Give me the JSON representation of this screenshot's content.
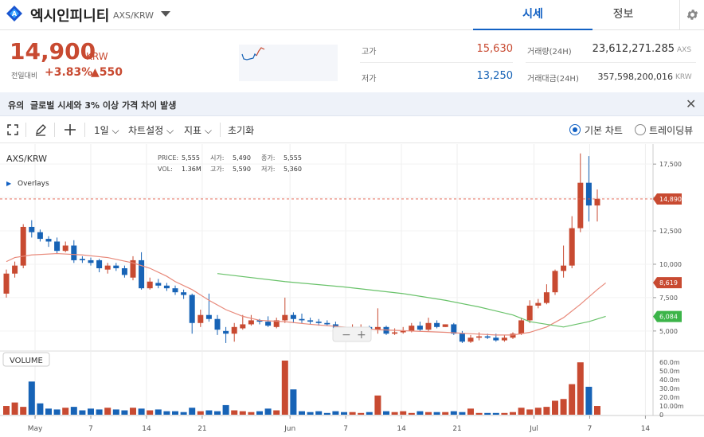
{
  "header": {
    "coin_name": "엑시인피니티",
    "coin_code": "AXS/KRW",
    "tabs": [
      {
        "label": "시세",
        "active": true
      },
      {
        "label": "정보",
        "active": false
      }
    ],
    "settings_icon": "gear-icon"
  },
  "summary": {
    "price": "14,900",
    "unit": "KRW",
    "change_label": "전일대비",
    "change_rate": "+3.83%",
    "change_amount": "▲550",
    "high_label": "고가",
    "high_value": "15,630",
    "low_label": "저가",
    "low_value": "13,250",
    "volume_label": "거래량(24H)",
    "volume_value": "23,612,271.285",
    "volume_unit": "AXS",
    "amount_label": "거래대금(24H)",
    "amount_value": "357,598,200,016",
    "amount_unit": "KRW"
  },
  "notice": {
    "tag": "유의",
    "text": "글로벌 시세와 3% 이상 가격 차이 발생",
    "close_icon": "close-icon"
  },
  "toolbar": {
    "fullscreen_icon": "fullscreen-icon",
    "draw_icon": "pencil-icon",
    "crosshair_icon": "crosshair-icon",
    "interval": "1일",
    "chart_settings": "차트설정",
    "indicators": "지표",
    "reset": "초기화",
    "mode_basic": "기본 차트",
    "mode_tradingview": "트레이딩뷰",
    "selected_mode": "기본 차트"
  },
  "chart_info": {
    "symbol": "AXS/KRW",
    "overlays": "Overlays",
    "price_label": "PRICE:",
    "price_value": "5,555",
    "open_label": "시가:",
    "open_value": "5,490",
    "close_label": "종가:",
    "close_value": "5,555",
    "vol_label": "VOL:",
    "vol_value": "1.36M",
    "high_label": "고가:",
    "high_value": "5,590",
    "low_label": "저가:",
    "low_value": "5,360",
    "volume_panel_label": "VOLUME"
  },
  "colors": {
    "up": "#c84a31",
    "down": "#1763b6",
    "ma_short": "#e8897a",
    "ma_long": "#69c26a",
    "accent": "#1261c4"
  },
  "chart_data": {
    "type": "candlestick",
    "symbol": "AXS/KRW",
    "x_ticks": [
      "May",
      "7",
      "14",
      "21",
      "Jun",
      "7",
      "14",
      "21",
      "Jul",
      "7",
      "14"
    ],
    "y_ticks": [
      "17,500",
      "15,000",
      "12,500",
      "10,000",
      "7,500",
      "5,000"
    ],
    "y_range": [
      3500,
      19000
    ],
    "volume_ticks": [
      "60.0m",
      "50.0m",
      "40.0m",
      "30.0m",
      "20.0m",
      "10.00m",
      "0"
    ],
    "volume_range": [
      0,
      62
    ],
    "price_tags": [
      {
        "label": "14,890",
        "value": 14890,
        "color": "#c84a31"
      },
      {
        "label": "8,619",
        "value": 8619,
        "color": "#c84a31"
      },
      {
        "label": "6,084",
        "value": 6084,
        "color": "#3cb449"
      }
    ],
    "candles": [
      [
        7800,
        9300,
        7500,
        9600,
        10
      ],
      [
        9300,
        9900,
        9000,
        10200,
        14
      ],
      [
        9900,
        12800,
        9700,
        13000,
        9
      ],
      [
        12800,
        12400,
        12000,
        13300,
        38
      ],
      [
        12400,
        11900,
        11700,
        12600,
        13
      ],
      [
        11900,
        11700,
        11300,
        12100,
        7
      ],
      [
        11700,
        11000,
        10800,
        12000,
        6
      ],
      [
        11000,
        11400,
        10900,
        11700,
        8
      ],
      [
        11400,
        10300,
        10100,
        11800,
        9
      ],
      [
        10400,
        10300,
        10100,
        10600,
        5
      ],
      [
        10300,
        10100,
        9900,
        10500,
        7
      ],
      [
        10300,
        9700,
        9400,
        10400,
        6
      ],
      [
        9600,
        9900,
        9300,
        10100,
        8
      ],
      [
        9900,
        9700,
        9500,
        10100,
        6
      ],
      [
        9700,
        9200,
        9000,
        9900,
        5
      ],
      [
        9000,
        10300,
        8800,
        10600,
        8
      ],
      [
        10300,
        8200,
        8100,
        10900,
        7
      ],
      [
        8200,
        8700,
        8100,
        9000,
        5
      ],
      [
        8600,
        8400,
        8200,
        8900,
        6
      ],
      [
        8400,
        8200,
        8000,
        8600,
        4
      ],
      [
        8200,
        7900,
        7700,
        8400,
        4
      ],
      [
        7900,
        7700,
        7400,
        8100,
        3
      ],
      [
        7700,
        5600,
        4800,
        7800,
        8
      ],
      [
        5600,
        6200,
        5300,
        6600,
        4
      ],
      [
        6200,
        5900,
        5700,
        7800,
        5
      ],
      [
        5900,
        5100,
        4700,
        6200,
        4
      ],
      [
        5000,
        4800,
        4100,
        5300,
        11
      ],
      [
        4800,
        5300,
        4200,
        5600,
        5
      ],
      [
        5200,
        5500,
        5100,
        6200,
        4
      ],
      [
        5500,
        5800,
        5400,
        6200,
        3
      ],
      [
        5800,
        5700,
        5500,
        5900,
        4
      ],
      [
        5700,
        5400,
        5300,
        6100,
        7
      ],
      [
        5300,
        5800,
        5200,
        6000,
        5
      ],
      [
        5800,
        6200,
        5600,
        7500,
        62
      ],
      [
        6200,
        5900,
        5600,
        6400,
        29
      ],
      [
        5900,
        5800,
        5600,
        6300,
        4
      ],
      [
        5800,
        5700,
        5500,
        6000,
        3
      ],
      [
        5700,
        5600,
        5400,
        5900,
        4
      ],
      [
        5600,
        5500,
        5400,
        5800,
        2
      ],
      [
        5500,
        5200,
        5000,
        5700,
        4
      ],
      [
        5200,
        5100,
        4900,
        5300,
        3
      ],
      [
        5100,
        5200,
        5000,
        5500,
        3
      ],
      [
        5200,
        5300,
        4900,
        5500,
        2
      ],
      [
        5300,
        5100,
        4900,
        5400,
        3
      ],
      [
        5100,
        5300,
        4800,
        6700,
        22
      ],
      [
        5300,
        4800,
        4700,
        5400,
        4
      ],
      [
        4800,
        4900,
        4700,
        5200,
        3
      ],
      [
        4900,
        5000,
        4800,
        5300,
        4
      ],
      [
        5000,
        5400,
        4900,
        5600,
        2
      ],
      [
        5400,
        5100,
        5000,
        5700,
        4
      ],
      [
        5100,
        5600,
        5000,
        6000,
        3
      ],
      [
        5600,
        5300,
        5200,
        5800,
        3
      ],
      [
        5300,
        5500,
        5300,
        5500,
        3
      ],
      [
        5500,
        4800,
        4700,
        5600,
        4
      ],
      [
        4800,
        4200,
        4100,
        5000,
        3
      ],
      [
        4200,
        4500,
        4100,
        4700,
        7
      ],
      [
        4500,
        4600,
        4300,
        4900,
        2
      ],
      [
        4600,
        4500,
        4400,
        4800,
        2
      ],
      [
        4500,
        4300,
        4200,
        4800,
        2
      ],
      [
        4300,
        4500,
        4200,
        4700,
        2
      ],
      [
        4500,
        4800,
        4400,
        4900,
        3
      ],
      [
        4800,
        5800,
        4700,
        6000,
        8
      ],
      [
        5800,
        6900,
        5600,
        7300,
        6
      ],
      [
        6900,
        7100,
        6700,
        7400,
        8
      ],
      [
        7100,
        7900,
        7000,
        8500,
        9
      ],
      [
        7900,
        9500,
        7700,
        9600,
        16
      ],
      [
        9500,
        9900,
        9000,
        11400,
        18
      ],
      [
        9900,
        12700,
        9700,
        13600,
        35
      ],
      [
        12700,
        16100,
        12400,
        18300,
        60
      ],
      [
        16100,
        14400,
        13200,
        18100,
        32
      ],
      [
        14400,
        14900,
        13200,
        15600,
        10
      ]
    ],
    "ma_short": [
      [
        10200,
        0
      ],
      [
        10500,
        1
      ],
      [
        10700,
        3
      ],
      [
        10800,
        6
      ],
      [
        10700,
        9
      ],
      [
        10500,
        12
      ],
      [
        10100,
        15
      ],
      [
        9700,
        17
      ],
      [
        9100,
        19
      ],
      [
        8700,
        20
      ],
      [
        8100,
        22
      ],
      [
        7300,
        24
      ],
      [
        6600,
        26
      ],
      [
        6100,
        28
      ],
      [
        5800,
        30
      ],
      [
        5700,
        33
      ],
      [
        5500,
        36
      ],
      [
        5300,
        40
      ],
      [
        5100,
        44
      ],
      [
        5000,
        48
      ],
      [
        4900,
        52
      ],
      [
        4800,
        55
      ],
      [
        4700,
        58
      ],
      [
        4700,
        60
      ],
      [
        4900,
        62
      ],
      [
        5300,
        64
      ],
      [
        6000,
        66
      ],
      [
        7000,
        68
      ],
      [
        8100,
        70
      ],
      [
        8600,
        71
      ]
    ],
    "ma_long": [
      [
        9300,
        25
      ],
      [
        8700,
        33
      ],
      [
        8300,
        40
      ],
      [
        7800,
        47
      ],
      [
        7300,
        52
      ],
      [
        6800,
        56
      ],
      [
        6200,
        60
      ],
      [
        5700,
        62
      ],
      [
        5500,
        64
      ],
      [
        5300,
        66
      ],
      [
        5700,
        69
      ],
      [
        6100,
        71
      ]
    ]
  }
}
